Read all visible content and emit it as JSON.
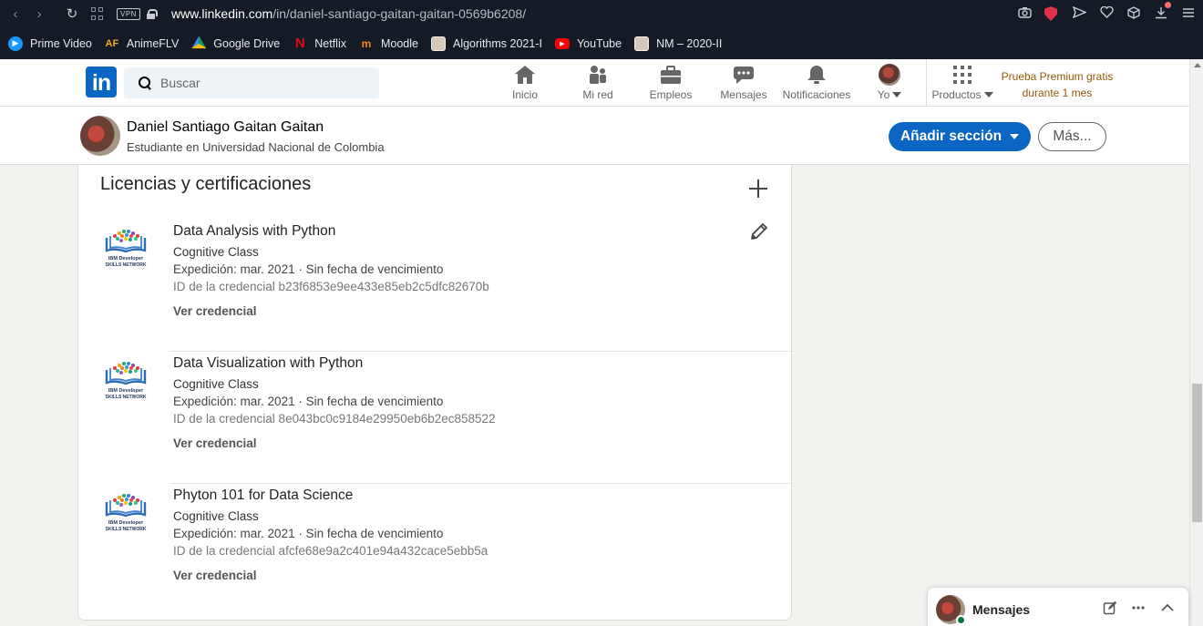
{
  "browser": {
    "url_domain": "www.linkedin.com",
    "url_path": "/in/daniel-santiago-gaitan-gaitan-0569b6208/",
    "vpn_label": "VPN",
    "bookmarks": [
      {
        "label": "Prime Video",
        "icon": "prime-video-icon"
      },
      {
        "label": "AnimeFLV",
        "icon": "animeflv-icon"
      },
      {
        "label": "Google Drive",
        "icon": "google-drive-icon"
      },
      {
        "label": "Netflix",
        "icon": "netflix-icon"
      },
      {
        "label": "Moodle",
        "icon": "moodle-icon"
      },
      {
        "label": "Algorithms 2021-I",
        "icon": "unal-icon"
      },
      {
        "label": "YouTube",
        "icon": "youtube-icon"
      },
      {
        "label": "NM – 2020-II",
        "icon": "unal-icon"
      }
    ]
  },
  "header": {
    "logo": "in",
    "search_placeholder": "Buscar",
    "nav": [
      {
        "label": "Inicio",
        "icon": "home-icon"
      },
      {
        "label": "Mi red",
        "icon": "network-icon"
      },
      {
        "label": "Empleos",
        "icon": "briefcase-icon"
      },
      {
        "label": "Mensajes",
        "icon": "chat-icon"
      },
      {
        "label": "Notificaciones",
        "icon": "bell-icon"
      },
      {
        "label": "Yo",
        "icon": "avatar"
      },
      {
        "label": "Productos",
        "icon": "grid-icon"
      }
    ],
    "premium_line1": "Prueba Premium gratis",
    "premium_line2": "durante 1 mes",
    "premium_color": "#915907"
  },
  "profile": {
    "name": "Daniel Santiago Gaitan Gaitan",
    "headline": "Estudiante en Universidad Nacional de Colombia",
    "add_section_label": "Añadir sección",
    "more_label": "Más..."
  },
  "section": {
    "title": "Licencias y certificaciones",
    "certs": [
      {
        "name": "Data Analysis with Python",
        "issuer": "Cognitive Class",
        "dates": "Expedición: mar. 2021 · Sin fecha de vencimiento",
        "credential_id": "ID de la credencial b23f6853e9ee433e85eb2c5dfc82670b",
        "link": "Ver credencial"
      },
      {
        "name": "Data Visualization with Python",
        "issuer": "Cognitive Class",
        "dates": "Expedición: mar. 2021 · Sin fecha de vencimiento",
        "credential_id": "ID de la credencial 8e043bc0c9184e29950eb6b2ec858522",
        "link": "Ver credencial"
      },
      {
        "name": "Phyton 101 for Data Science",
        "issuer": "Cognitive Class",
        "dates": "Expedición: mar. 2021 · Sin fecha de vencimiento",
        "credential_id": "ID de la credencial afcfe68e9a2c401e94a432cace5ebb5a",
        "link": "Ver credencial"
      }
    ],
    "logo_text_line1": "IBM Developer",
    "logo_text_line2": "SKILLS NETWORK"
  },
  "messaging": {
    "label": "Mensajes"
  },
  "colors": {
    "linkedin_blue": "#0a66c2",
    "browser_bg": "#141b26",
    "page_bg": "#f3f2ef",
    "online_green": "#057642"
  }
}
